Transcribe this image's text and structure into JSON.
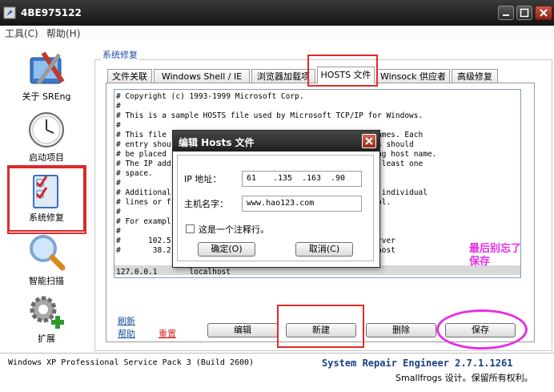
{
  "window": {
    "title": "4BE975122"
  },
  "menu": {
    "items": [
      "工具(C)",
      "帮助(H)"
    ]
  },
  "sidebar": {
    "items": [
      {
        "label": "关于 SREng",
        "icon": "tools-icon"
      },
      {
        "label": "启动项目",
        "icon": "clock-icon"
      },
      {
        "label": "系统修复",
        "icon": "checklist-icon",
        "selected": true
      },
      {
        "label": "智能扫描",
        "icon": "magnifier-icon"
      },
      {
        "label": "扩展",
        "icon": "gear-plus-icon"
      }
    ]
  },
  "group_title": "系统修复",
  "tabs": [
    "文件关联",
    "Windows Shell / IE",
    "浏览器加载项",
    "HOSTS 文件",
    "Winsock 供应者",
    "高级修复"
  ],
  "active_tab": "HOSTS 文件",
  "hosts": {
    "text": "# Copyright (c) 1993-1999 Microsoft Corp.\n#\n# This is a sample HOSTS file used by Microsoft TCP/IP for Windows.\n#\n# This file                                          st names. Each\n# entry shou                                         dress should\n# be placed                                          onding host name.\n# The IP add                                         y at least one\n# space.\n#\n# Additional                                         d on individual\n# lines or f                                         symbol.\n#\n# For exampl\n#\n#      102.5                                         e server\n#       38.2                                         ent host\n",
    "selected_line": "127.0.0.1       localhost"
  },
  "links": {
    "refresh": "刷新",
    "help": "帮助",
    "reset": "重置"
  },
  "buttons": {
    "edit": "编辑",
    "new": "新建",
    "delete": "删除",
    "save": "保存"
  },
  "status": {
    "os": "Windows XP Professional Service Pack 3 (Build 2600)",
    "product": "System Repair Engineer 2.7.1.1261",
    "copyright": "Smallfrogs 设计。保留所有权利。"
  },
  "dialog": {
    "title": "编辑 Hosts 文件",
    "ip_label": "IP 地址：",
    "ip_parts": [
      "61",
      ".135",
      ".163",
      ".90"
    ],
    "host_label": "主机名字：",
    "host_value": "www.hao123.com",
    "comment_label": "这是一个注释行。",
    "ok": "确定(O)",
    "cancel": "取消(C)"
  },
  "annotation": {
    "note": "最后别忘了保存"
  },
  "colors": {
    "annotation_pink": "#e52fe5",
    "annotation_red": "#e02a2a",
    "link_blue": "#1a4fa0"
  }
}
